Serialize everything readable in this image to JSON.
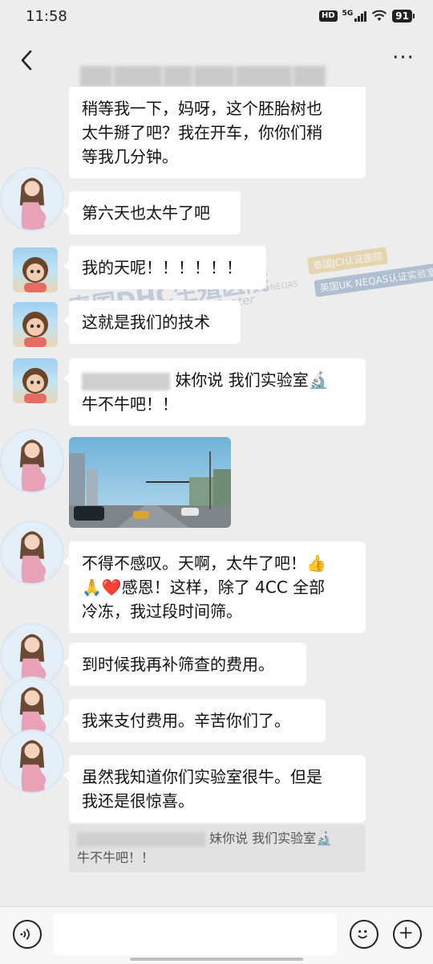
{
  "status_bar": {
    "time": "11:58",
    "hd": "HD",
    "network": "5G",
    "battery": "91"
  },
  "nav": {
    "back_icon": "chevron-left-icon",
    "more_label": "···"
  },
  "messages": [
    {
      "id": "m1",
      "lines": [
        "稍等我一下，妈呀，这个胚胎树也",
        "太牛掰了吧？我在开车，你你们稍",
        "等我几分钟。"
      ]
    },
    {
      "id": "m2",
      "text": "第六天也太牛了吧"
    },
    {
      "id": "m3",
      "text": "我的天呢！！！！！！"
    },
    {
      "id": "m4",
      "text": "这就是我们的技术"
    },
    {
      "id": "m5",
      "line1_suffix": "妹你说 我们实验室🔬",
      "line2": "牛不牛吧！！"
    },
    {
      "id": "m7",
      "lines": [
        "不得不感叹。天啊，太牛了吧！👍",
        "🙏❤️感恩！这样，除了 4CC 全部",
        "冷冻，我过段时间筛。"
      ]
    },
    {
      "id": "m8",
      "text": "到时候我再补筛查的费用。"
    },
    {
      "id": "m9",
      "text": "我来支付费用。辛苦你们了。"
    },
    {
      "id": "m10",
      "lines": [
        "虽然我知道你们实验室很牛。但是",
        "我还是很惊喜。"
      ]
    }
  ],
  "quote": {
    "line1_suffix": "妹你说 我们实验室🔬",
    "line2": "牛不牛吧！！"
  },
  "watermark": {
    "main": "泰国DHC生殖医院",
    "sub": "DHC Harmonicare IVF Center",
    "badge1": "泰国JCI认证医院",
    "badge2": "英国UK NEQAS认证实验室",
    "ukneqas": "UK NEQAS"
  },
  "input_bar": {
    "placeholder": ""
  }
}
